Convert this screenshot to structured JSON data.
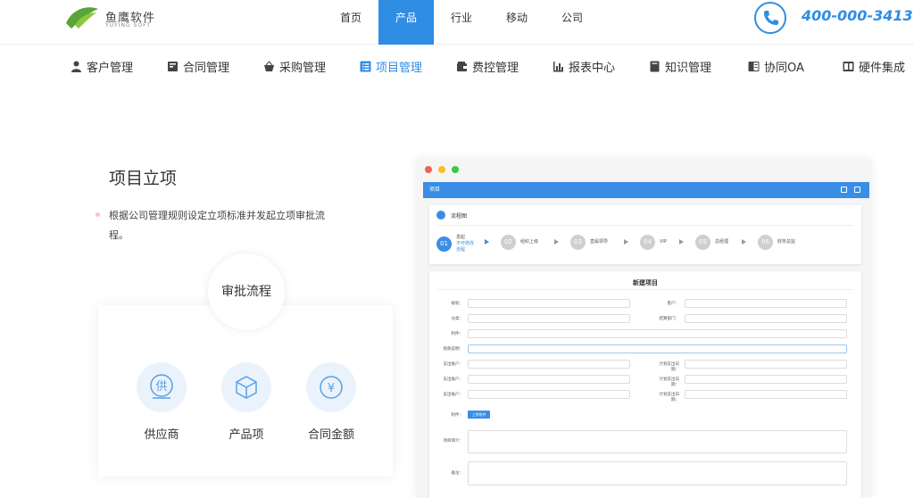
{
  "brand": {
    "name": "鱼鹰软件",
    "sub": "YUYING SOFT"
  },
  "nav": [
    {
      "label": "首页",
      "active": false
    },
    {
      "label": "产品",
      "active": true
    },
    {
      "label": "行业",
      "active": false
    },
    {
      "label": "移动",
      "active": false
    },
    {
      "label": "公司",
      "active": false
    }
  ],
  "phone": "400-000-3413",
  "subnav": [
    {
      "label": "客户管理",
      "icon": "person-icon"
    },
    {
      "label": "合同管理",
      "icon": "contract-icon"
    },
    {
      "label": "采购管理",
      "icon": "basket-icon"
    },
    {
      "label": "项目管理",
      "icon": "list-icon",
      "active": true
    },
    {
      "label": "费控管理",
      "icon": "wallet-icon"
    },
    {
      "label": "报表中心",
      "icon": "chart-icon"
    },
    {
      "label": "知识管理",
      "icon": "book-icon"
    },
    {
      "label": "协同OA",
      "icon": "oa-icon"
    },
    {
      "label": "硬件集成",
      "icon": "hardware-icon"
    }
  ],
  "section": {
    "title": "项目立项",
    "desc": "根据公司管理规则设定立项标准并发起立项审批流程。",
    "approval": "审批流程",
    "features": [
      {
        "label": "供应商",
        "glyph": "供"
      },
      {
        "label": "产品项",
        "glyph": "⬡"
      },
      {
        "label": "合同金额",
        "glyph": "¥"
      }
    ]
  },
  "screenshot": {
    "appbar_title": "项目",
    "flow_title": "流程图",
    "steps": [
      {
        "num": "01",
        "label": "发起",
        "sub1": "不可修改",
        "sub2": "流程",
        "current": true
      },
      {
        "num": "02",
        "label": "组织上级"
      },
      {
        "num": "03",
        "label": "直属领导"
      },
      {
        "num": "04",
        "label": "VIP"
      },
      {
        "num": "05",
        "label": "总经理"
      },
      {
        "num": "06",
        "label": "财务总监"
      }
    ],
    "form_title": "新建项目",
    "fields": {
      "f1": "规机：",
      "f2": "客户：",
      "f3": "分类：",
      "f4": "结算部门：",
      "f5": "附件：",
      "f6": "限款说明：",
      "f7": "支出账户：",
      "f8": "计划支出日期：",
      "f9": "支出账户：",
      "f10": "计划支出日期：",
      "f11": "支出账户：",
      "f12": "计划支出日期：",
      "f13": "附件：",
      "f14": "项目简介：",
      "f15": "备注："
    },
    "upload": "上传附件"
  },
  "colors": {
    "accent": "#2f8de4",
    "dot_red": "#f25f57",
    "dot_yellow": "#f6be2f",
    "dot_green": "#3dc840"
  }
}
